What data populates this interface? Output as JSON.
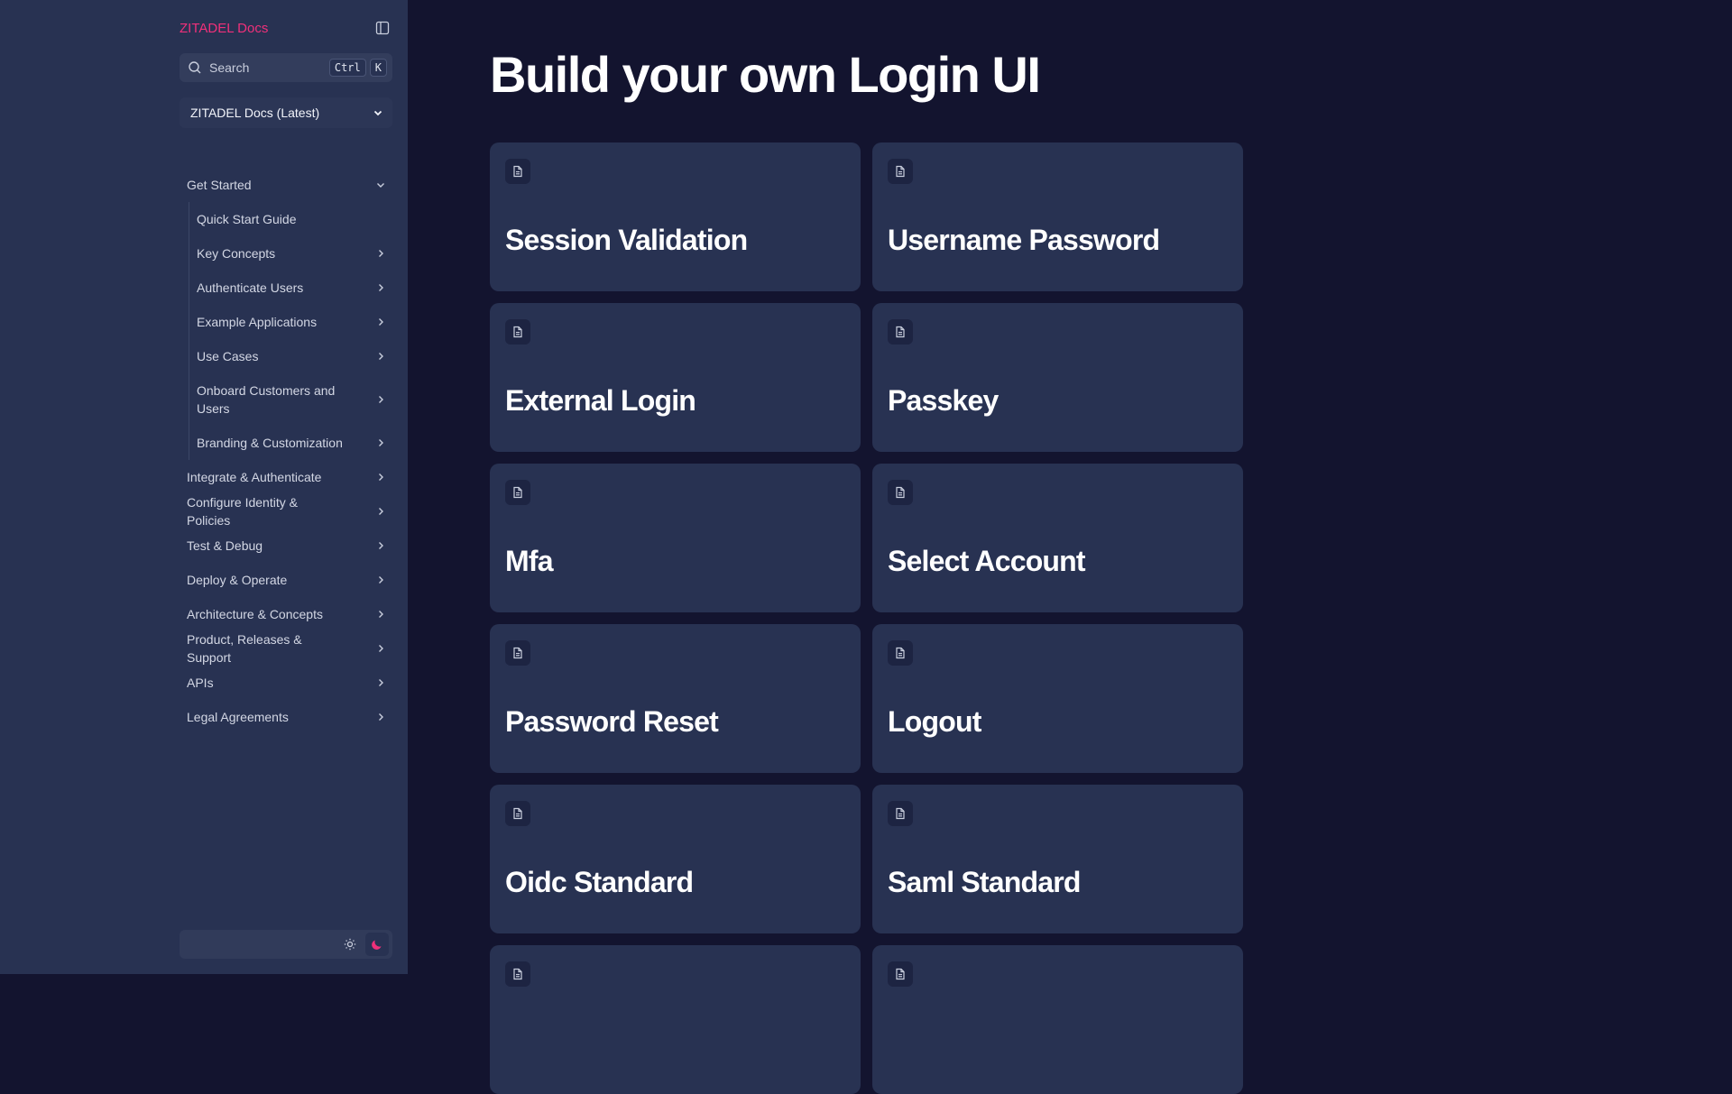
{
  "sidebar": {
    "brand": "ZITADEL Docs",
    "search": {
      "placeholder": "Search",
      "kbd_1": "Ctrl",
      "kbd_2": "K"
    },
    "version": "ZITADEL Docs (Latest)",
    "nav": {
      "get_started": "Get Started",
      "sub": [
        "Quick Start Guide",
        "Key Concepts",
        "Authenticate Users",
        "Example Applications",
        "Use Cases",
        "Onboard Customers and Users",
        "Branding & Customization"
      ],
      "top": [
        "Integrate & Authenticate",
        "Configure Identity & Policies",
        "Test & Debug",
        "Deploy & Operate",
        "Architecture & Concepts",
        "Product, Releases & Support",
        "APIs",
        "Legal Agreements"
      ]
    }
  },
  "main": {
    "title": "Build your own Login UI",
    "cards": [
      "Session Validation",
      "Username Password",
      "External Login",
      "Passkey",
      "Mfa",
      "Select Account",
      "Password Reset",
      "Logout",
      "Oidc Standard",
      "Saml Standard",
      "",
      ""
    ]
  },
  "colors": {
    "brand": "#f0307a",
    "sidebar_bg": "#283252",
    "main_bg": "#13142f",
    "card_bg": "#283252"
  }
}
